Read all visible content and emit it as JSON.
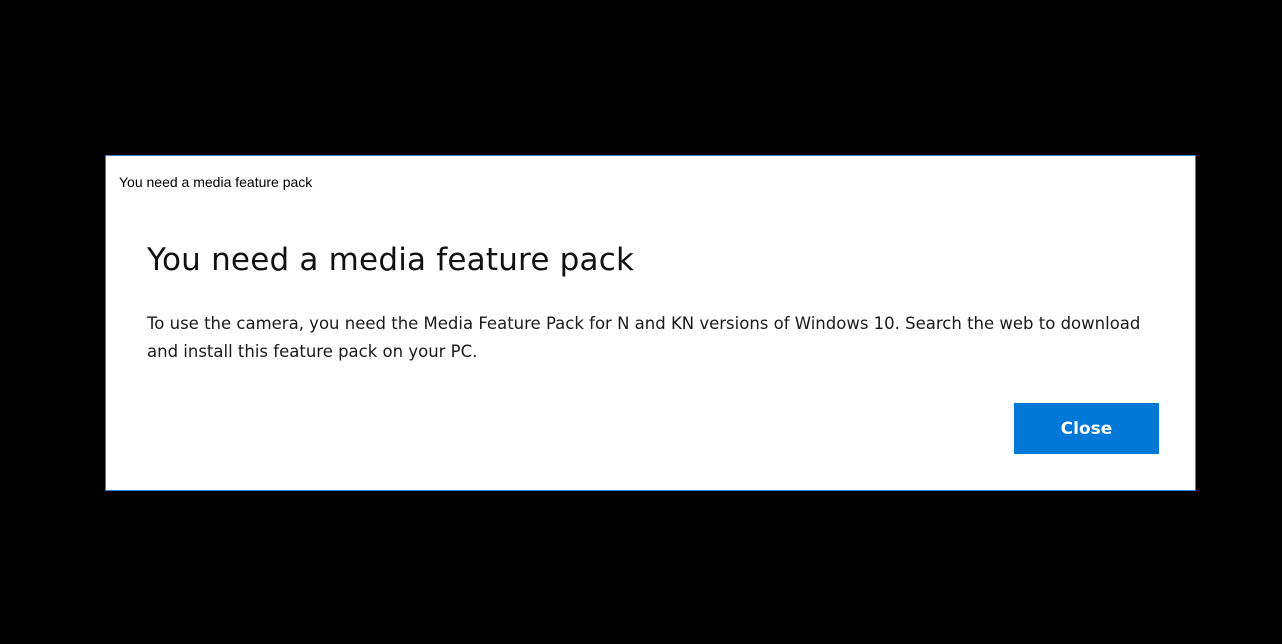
{
  "dialog": {
    "window_title": "You need a media feature pack",
    "heading": "You need a media feature pack",
    "message": "To use the camera, you need the Media Feature Pack for N and KN versions of Windows 10. Search the web to download and install this feature pack on your PC.",
    "close_label": "Close",
    "accent_color": "#0078d7",
    "border_color": "#2b7fd4"
  }
}
